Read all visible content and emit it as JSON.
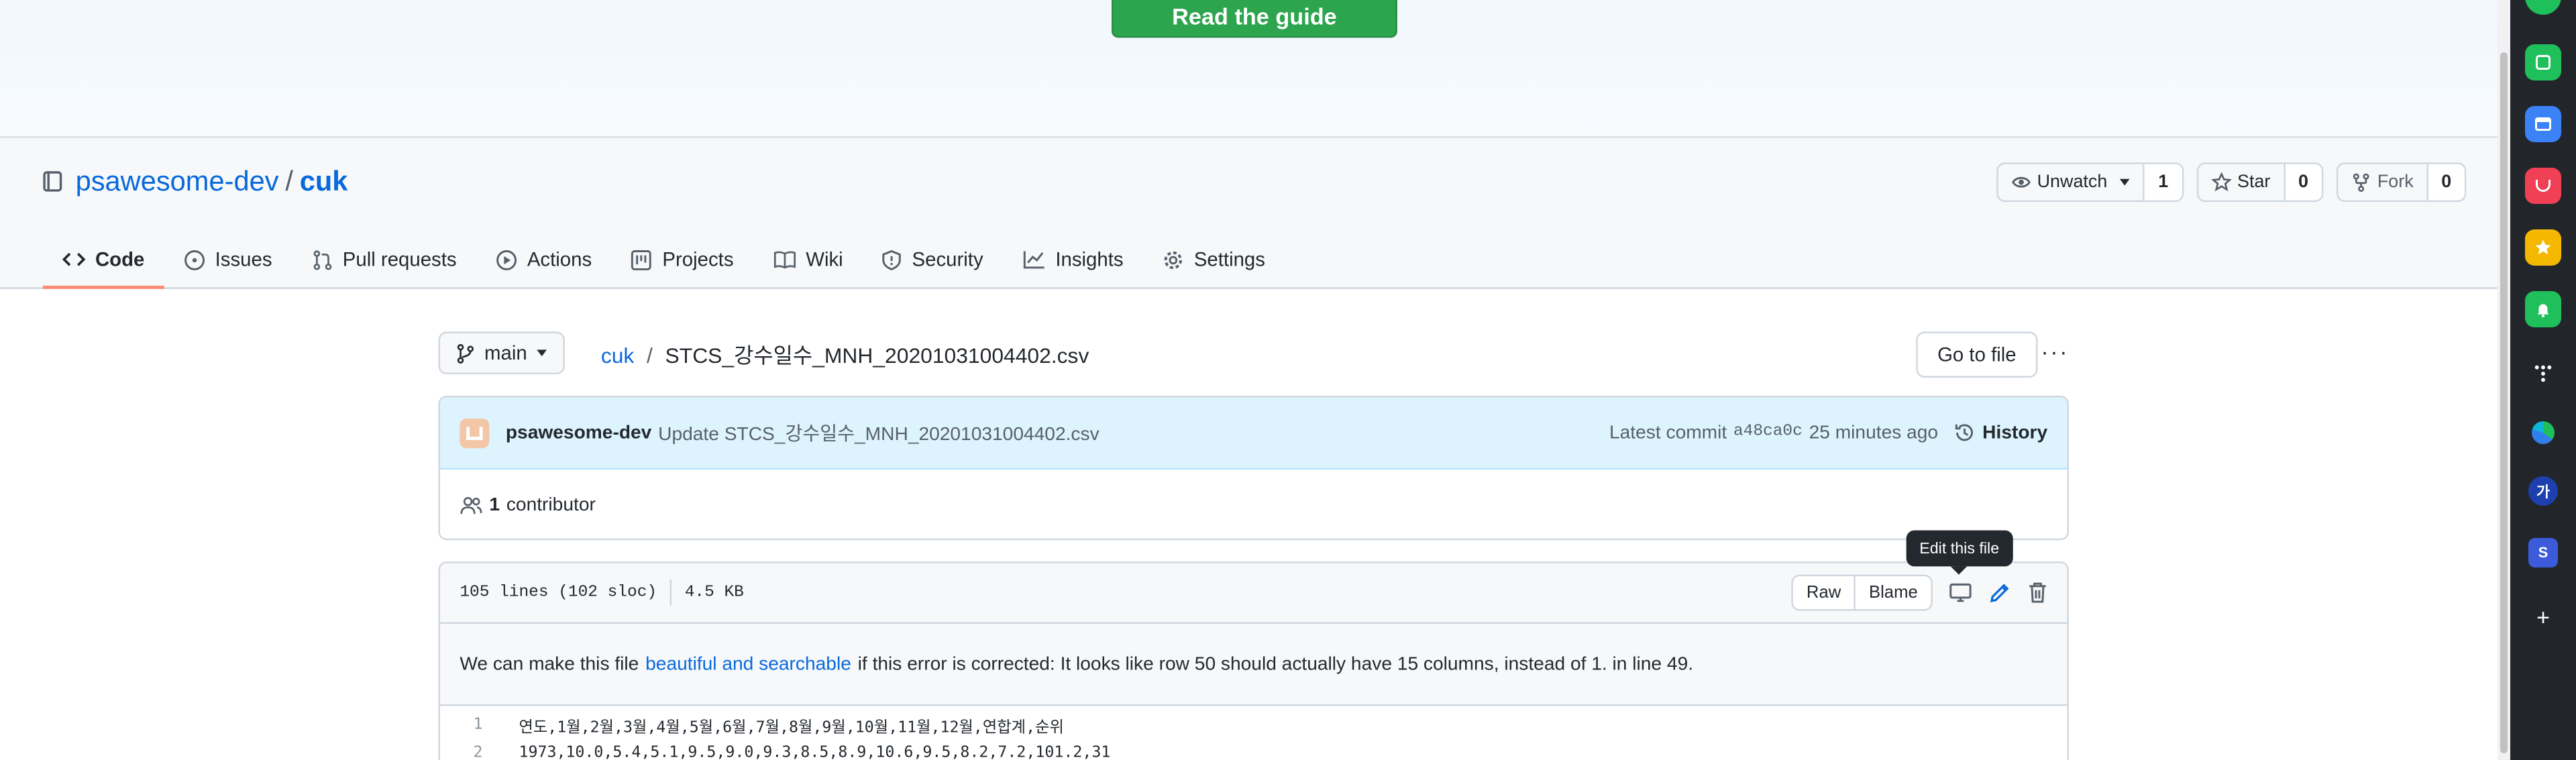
{
  "banner": {
    "guide_button": "Read the guide"
  },
  "repo": {
    "owner": "psawesome-dev",
    "separator": "/",
    "name": "cuk",
    "watch": {
      "label": "Unwatch",
      "count": "1"
    },
    "star": {
      "label": "Star",
      "count": "0"
    },
    "fork": {
      "label": "Fork",
      "count": "0"
    }
  },
  "tabs": [
    {
      "label": "Code",
      "icon": "code-icon",
      "active": true
    },
    {
      "label": "Issues",
      "icon": "issue-icon"
    },
    {
      "label": "Pull requests",
      "icon": "pull-request-icon"
    },
    {
      "label": "Actions",
      "icon": "play-icon"
    },
    {
      "label": "Projects",
      "icon": "project-icon"
    },
    {
      "label": "Wiki",
      "icon": "book-icon"
    },
    {
      "label": "Security",
      "icon": "shield-icon"
    },
    {
      "label": "Insights",
      "icon": "graph-icon"
    },
    {
      "label": "Settings",
      "icon": "gear-icon"
    }
  ],
  "file_nav": {
    "branch": "main",
    "root": "cuk",
    "separator": "/",
    "filename": "STCS_강수일수_MNH_20201031004402.csv",
    "go_to_file": "Go to file",
    "more": "···"
  },
  "commit": {
    "author": "psawesome-dev",
    "message": "Update STCS_강수일수_MNH_20201031004402.csv",
    "latest_label": "Latest commit",
    "sha": "a48ca0c",
    "time": "25 minutes ago",
    "history": "History",
    "contributors_count": "1",
    "contributors_label": "contributor"
  },
  "file": {
    "lines_info": "105 lines (102 sloc)",
    "size": "4.5 KB",
    "raw": "Raw",
    "blame": "Blame",
    "tooltip": "Edit this file",
    "warning_before": "We can make this file",
    "warning_link": "beautiful and searchable",
    "warning_after": "if this error is corrected: It looks like row 50 should actually have 15 columns, instead of 1. in line 49.",
    "lines": [
      {
        "num": "1",
        "text": "연도,1월,2월,3월,4월,5월,6월,7월,8월,9월,10월,11월,12월,연합계,순위"
      },
      {
        "num": "2",
        "text": "1973,10.0,5.4,5.1,9.5,9.0,9.3,8.5,8.9,10.6,9.5,8.2,7.2,101.2,31"
      }
    ]
  },
  "edge_sidebar": {
    "items": [
      {
        "icon": "green-circle-icon",
        "color": "#1fbf5c",
        "label": ""
      },
      {
        "icon": "calendar-icon",
        "color": "#3b82f6",
        "label": ""
      },
      {
        "icon": "pocket-icon",
        "color": "#ef4056",
        "label": ""
      },
      {
        "icon": "star-icon",
        "color": "#f5b800",
        "label": ""
      },
      {
        "icon": "bell-icon",
        "color": "#1fbf5c",
        "label": ""
      },
      {
        "icon": "dots-icon",
        "color": "#22262b",
        "label": ""
      },
      {
        "icon": "edge-icon",
        "color": "#22262b",
        "label": ""
      },
      {
        "icon": "korean-char-icon",
        "color": "#1e40af",
        "label": "가"
      },
      {
        "icon": "s-app-icon",
        "color": "#3b5bdb",
        "label": "S"
      },
      {
        "icon": "add-icon",
        "color": "#22262b",
        "label": "+"
      }
    ]
  }
}
